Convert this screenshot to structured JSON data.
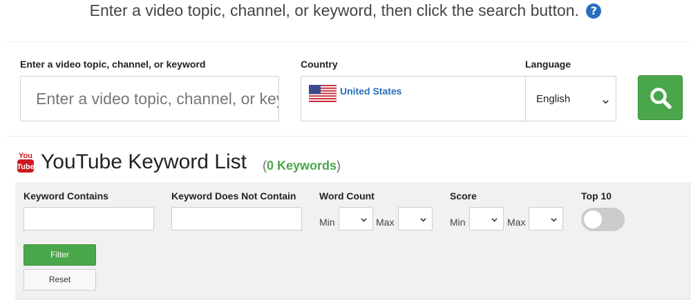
{
  "header": {
    "instruction": "Enter a video topic, channel, or keyword, then click the search button.",
    "help_icon": "question-circle-icon",
    "help_icon_glyph": "?"
  },
  "search": {
    "topic_label": "Enter a video topic, channel, or keyword",
    "topic_placeholder": "Enter a video topic, channel, or keyword",
    "topic_value": "",
    "country_label": "Country",
    "country_value": "United States",
    "country_flag_icon": "us-flag-icon",
    "language_label": "Language",
    "language_value": "English",
    "search_button_icon": "search-icon"
  },
  "keyword_list": {
    "logo_icon": "youtube-logo-icon",
    "logo_text_top": "You",
    "logo_text_bottom": "Tube",
    "title": "YouTube Keyword List",
    "count_open": "(",
    "count_label": "0 Keywords",
    "count_close": ")"
  },
  "filters": {
    "contains_label": "Keyword Contains",
    "contains_value": "",
    "not_contains_label": "Keyword Does Not Contain",
    "not_contains_value": "",
    "word_count_label": "Word Count",
    "score_label": "Score",
    "min_label": "Min",
    "max_label": "Max",
    "top10_label": "Top 10",
    "top10_on": false,
    "filter_button": "Filter",
    "reset_button": "Reset"
  },
  "colors": {
    "accent_green": "#4aa64a",
    "link_blue": "#2a6ebd",
    "youtube_red": "#cc181e",
    "panel_gray": "#f1f1f1"
  }
}
